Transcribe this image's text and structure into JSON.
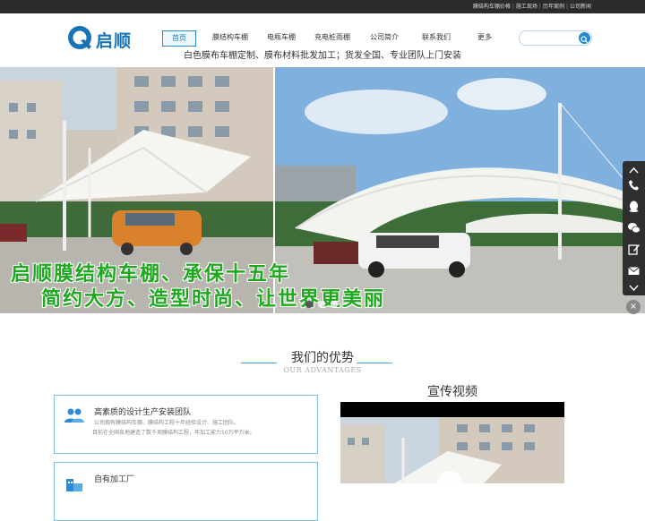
{
  "top_links": [
    "膜结构车棚价格",
    "施工现场",
    "历年案例",
    "公司新闻"
  ],
  "logo": {
    "text": "启顺"
  },
  "nav": {
    "items": [
      "首页",
      "膜结构车棚",
      "电瓶车棚",
      "充电桩雨棚",
      "公司简介",
      "联系我们",
      "更多"
    ],
    "active_index": 0
  },
  "search": {
    "placeholder": ""
  },
  "slogan": "白色膜布车棚定制、膜布材料批发加工；货发全国、专业团队上门安装",
  "banner": {
    "line1": "启顺膜结构车棚、承保十五年",
    "line2": "简约大方、造型时尚、让世界更美丽",
    "slide_count": 3,
    "active_slide": 0
  },
  "side_tools": [
    "chevron-up-icon",
    "phone-icon",
    "qq-icon",
    "wechat-icon",
    "edit-icon",
    "mail-icon",
    "chevron-down-icon"
  ],
  "side_close": "×",
  "advantages": {
    "title": "我们的优势",
    "subtitle": "OUR ADVANTAGES",
    "cards": [
      {
        "title": "高素质的设计生产安装团队",
        "desc1": "公司拥有膜结构车棚、膜结构工程十年经验设计、施工团队。",
        "desc2": "目前在全国各地建造了数千项膜结构工程，年加工能力10万平方米。"
      },
      {
        "title": "自有加工厂",
        "desc1": "",
        "desc2": ""
      }
    ]
  },
  "video": {
    "title": "宣传视频"
  },
  "colors": {
    "accent": "#1e8ad6",
    "banner_text": "#1ea81e",
    "topbar": "#2b2b2b"
  }
}
